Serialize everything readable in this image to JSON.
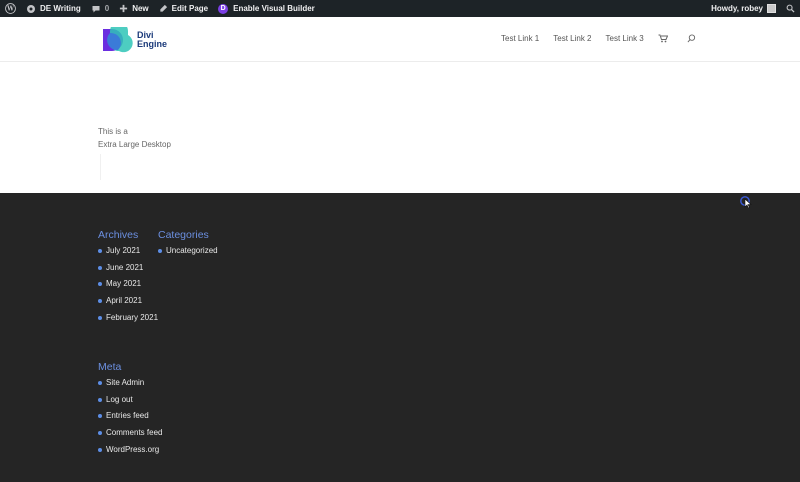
{
  "admin_bar": {
    "site_name": "DE Writing",
    "comments_count": "0",
    "new_label": "New",
    "edit_page_label": "Edit Page",
    "visual_builder_label": "Enable Visual Builder",
    "greeting": "Howdy, robey"
  },
  "header": {
    "logo_line1": "Divi",
    "logo_line2": "Engine",
    "nav": [
      "Test Link 1",
      "Test Link 2",
      "Test Link 3"
    ]
  },
  "content": {
    "line1": "This is a",
    "line2": "Extra Large Desktop"
  },
  "footer": {
    "archives": {
      "title": "Archives",
      "items": [
        "July 2021",
        "June 2021",
        "May 2021",
        "April 2021",
        "February 2021"
      ]
    },
    "categories": {
      "title": "Categories",
      "items": [
        "Uncategorized"
      ]
    },
    "meta": {
      "title": "Meta",
      "items": [
        "Site Admin",
        "Log out",
        "Entries feed",
        "Comments feed",
        "WordPress.org"
      ]
    }
  },
  "colors": {
    "admin_bar_bg": "#1d2327",
    "footer_bg": "#252525",
    "widget_title": "#6b8fe0",
    "bullet": "#5d8ee6",
    "divi_purple": "#7b3fe4"
  },
  "icons": [
    "wordpress-icon",
    "home-icon",
    "comment-icon",
    "plus-icon",
    "pencil-icon",
    "divi-icon",
    "avatar-icon",
    "search-icon",
    "cart-icon"
  ]
}
